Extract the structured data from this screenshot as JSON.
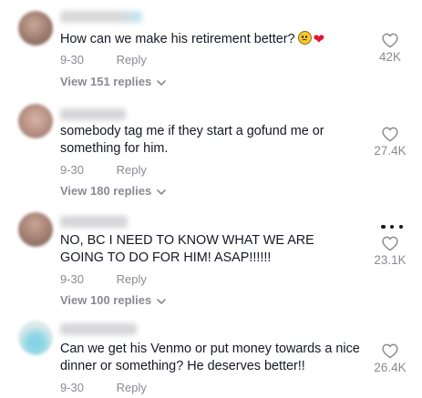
{
  "comments": [
    {
      "text": "How can we make his retirement better?",
      "emojis": [
        "worried-face-emoji",
        "red-heart-emoji"
      ],
      "date": "9-30",
      "reply_label": "Reply",
      "view_replies": "View 151 replies",
      "likes": "42K"
    },
    {
      "text": "somebody tag me if they start a gofund me or something for him.",
      "date": "9-30",
      "reply_label": "Reply",
      "view_replies": "View 180 replies",
      "likes": "27.4K"
    },
    {
      "text": "NO, BC I NEED TO KNOW WHAT WE ARE GOING TO DO FOR HIM! ASAP!!!!!!",
      "date": "9-30",
      "reply_label": "Reply",
      "view_replies": "View 100 replies",
      "likes": "23.1K",
      "has_more_menu": true
    },
    {
      "text": "Can we get his Venmo or put money towards a nice dinner or something? He deserves better!!",
      "date": "9-30",
      "reply_label": "Reply",
      "likes": "26.4K"
    }
  ],
  "icons": {
    "like": "heart-outline-icon",
    "more": "more-dots-icon",
    "expand": "chevron-down-icon"
  },
  "colors": {
    "text": "#161823",
    "muted": "#8a8b91",
    "heart_emoji": "#e0153a"
  }
}
